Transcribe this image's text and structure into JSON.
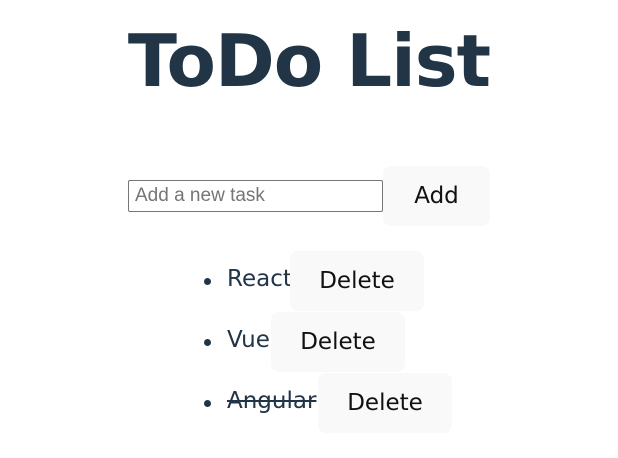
{
  "header": {
    "title": "ToDo List"
  },
  "add_form": {
    "input_placeholder": "Add a new task",
    "input_value": "",
    "add_label": "Add"
  },
  "tasks": [
    {
      "text": "React",
      "completed": false,
      "delete_label": "Delete"
    },
    {
      "text": "Vue",
      "completed": false,
      "delete_label": "Delete"
    },
    {
      "text": "Angular",
      "completed": true,
      "delete_label": "Delete"
    }
  ],
  "colors": {
    "text": "#213547",
    "button_bg": "#f9f9f9"
  }
}
